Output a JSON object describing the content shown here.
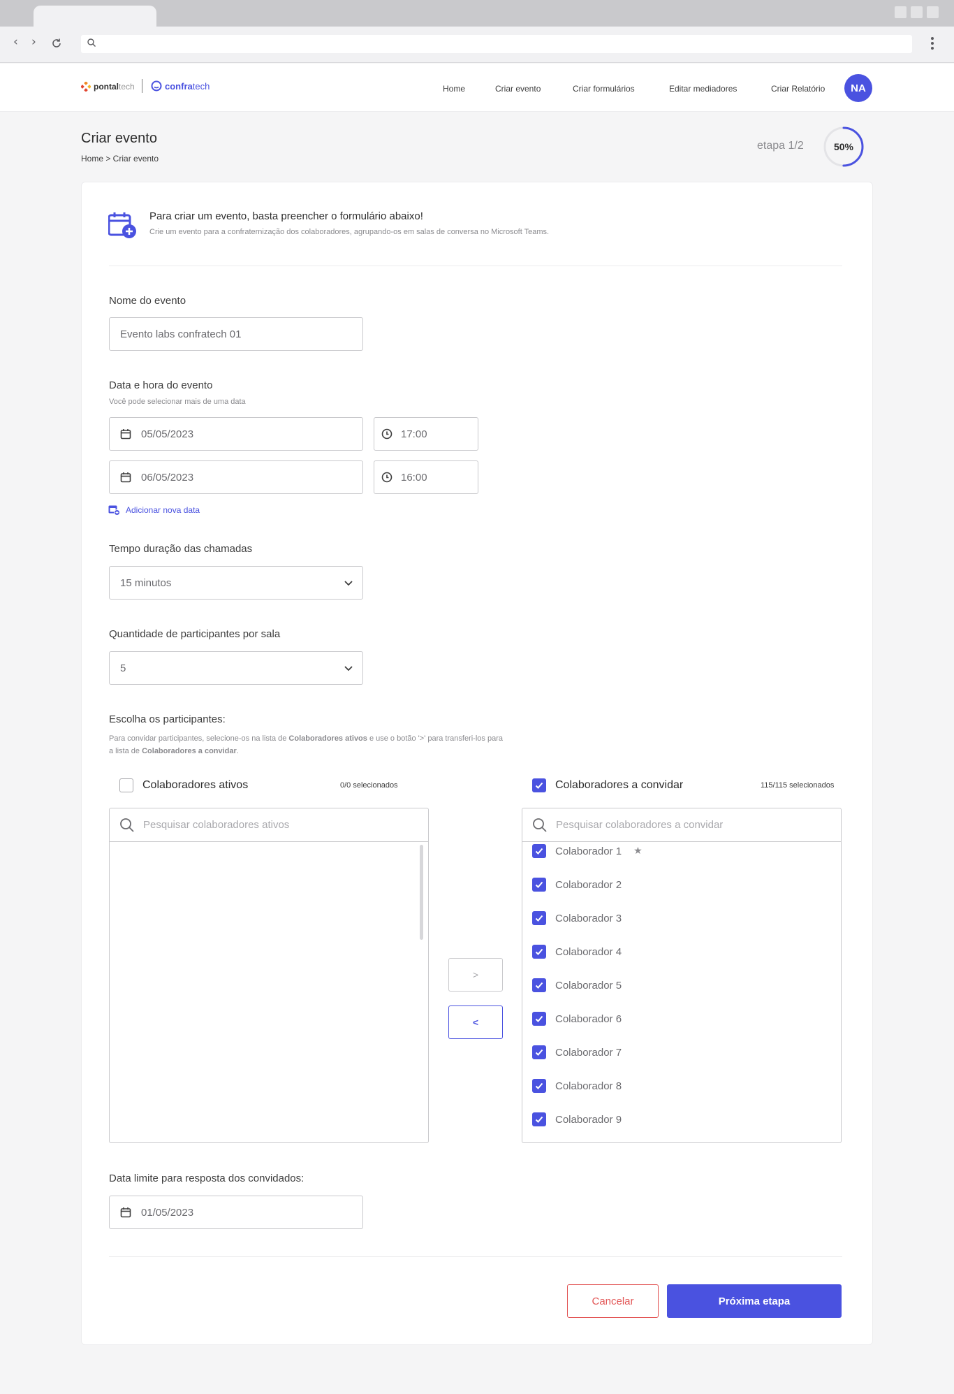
{
  "brand": {
    "pontal_bold": "pontal",
    "pontal_light": "tech",
    "confra_bold": "confra",
    "confra_light": "tech"
  },
  "nav": {
    "items": [
      "Home",
      "Criar evento",
      "Criar formulários",
      "Editar mediadores",
      "Criar Relatório"
    ],
    "avatar_initials": "NA"
  },
  "page": {
    "title": "Criar evento",
    "breadcrumb": "Home > Criar evento",
    "step": "etapa 1/2",
    "progress_label": "50%",
    "progress": 0.5
  },
  "intro": {
    "title": "Para criar um evento, basta preencher o formulário abaixo!",
    "subtitle": "Crie um evento para a confraternização dos colaboradores, agrupando-os em salas de conversa no Microsoft Teams."
  },
  "form": {
    "event_name_label": "Nome do evento",
    "event_name_value": "Evento labs confratech 01",
    "datetime_label": "Data e hora do evento",
    "datetime_help": "Você pode selecionar mais de uma data",
    "dates": [
      {
        "date": "05/05/2023",
        "time": "17:00"
      },
      {
        "date": "06/05/2023",
        "time": "16:00"
      }
    ],
    "add_date": "Adicionar nova data",
    "duration_label": "Tempo duração das chamadas",
    "duration_value": "15 minutos",
    "participants_per_room_label": "Quantidade de participantes por sala",
    "participants_per_room_value": "5",
    "choose_label": "Escolha os participantes:",
    "choose_help_1a": "Para convidar participantes, selecione-os na lista de ",
    "choose_help_1b": "Colaboradores ativos",
    "choose_help_1c": " e use o botão '>'  para transferi-los para",
    "choose_help_2a": "a lista de ",
    "choose_help_2b": "Colaboradores a convidar",
    "choose_help_2c": ".",
    "deadline_label": "Data limite para resposta dos convidados:",
    "deadline_value": "01/05/2023"
  },
  "active_list": {
    "title": "Colaboradores ativos",
    "count": "0/0 selecionados",
    "search_placeholder": "Pesquisar colaboradores ativos"
  },
  "invite_list": {
    "title": "Colaboradores a convidar",
    "count": "115/115 selecionados",
    "search_placeholder": "Pesquisar colaboradores a convidar",
    "items": [
      "Colaborador 1",
      "Colaborador 2",
      "Colaborador 3",
      "Colaborador 4",
      "Colaborador 5",
      "Colaborador 6",
      "Colaborador 7",
      "Colaborador 8",
      "Colaborador 9"
    ]
  },
  "transfer": {
    "to_invite": ">",
    "to_active": "<"
  },
  "actions": {
    "cancel": "Cancelar",
    "next": "Próxima etapa"
  },
  "colors": {
    "accent": "#4a52e0",
    "danger": "#e25555"
  }
}
